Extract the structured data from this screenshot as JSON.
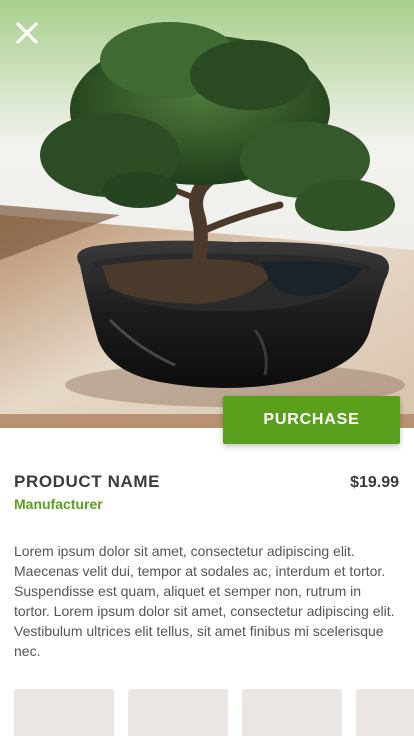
{
  "header": {
    "close_icon": "close-icon",
    "hero_image": "bonsai-in-dark-ceramic-pot"
  },
  "product": {
    "name": "PRODUCT NAME",
    "manufacturer": "Manufacturer",
    "price": "$19.99",
    "description": "Lorem ipsum dolor sit amet, consectetur adipiscing elit. Maecenas velit dui, tempor at sodales ac, interdum et tortor. Suspendisse est quam, aliquet et semper non, rutrum in tortor. Lorem ipsum dolor sit amet, consectetur adipiscing elit. Vestibulum ultrices elit tellus, sit amet finibus mi scelerisque nec."
  },
  "actions": {
    "purchase_label": "PURCHASE"
  },
  "gallery": {
    "thumbnail_count": 4
  },
  "colors": {
    "accent": "#5aa01c",
    "text_dark": "#3b3b3b",
    "text_body": "#555555",
    "thumb_bg": "#ece6e2",
    "strip": "#b99272"
  }
}
